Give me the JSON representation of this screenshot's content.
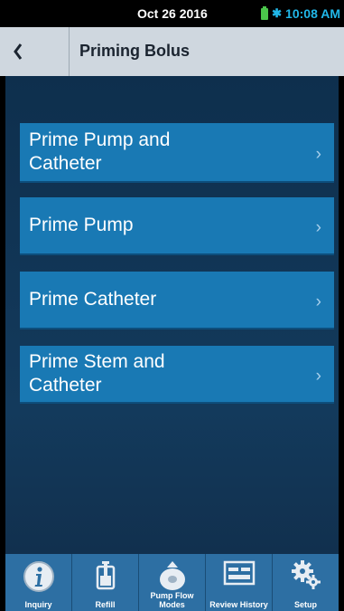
{
  "status": {
    "date": "Oct 26 2016",
    "time": "10:08 AM"
  },
  "header": {
    "title": "Priming Bolus"
  },
  "menu": [
    {
      "label": "Prime Pump and Catheter"
    },
    {
      "label": "Prime Pump"
    },
    {
      "label": "Prime Catheter"
    },
    {
      "label": "Prime Stem and Catheter"
    }
  ],
  "tabs": [
    {
      "label": "Inquiry",
      "icon": "info-icon"
    },
    {
      "label": "Refill",
      "icon": "refill-icon"
    },
    {
      "label": "Pump Flow Modes",
      "icon": "pump-flow-icon"
    },
    {
      "label": "Review History",
      "icon": "review-history-icon"
    },
    {
      "label": "Setup",
      "icon": "gears-icon"
    }
  ],
  "colors": {
    "accent": "#1979b4",
    "background": "#0e2f4d",
    "header": "#cfd7df"
  }
}
